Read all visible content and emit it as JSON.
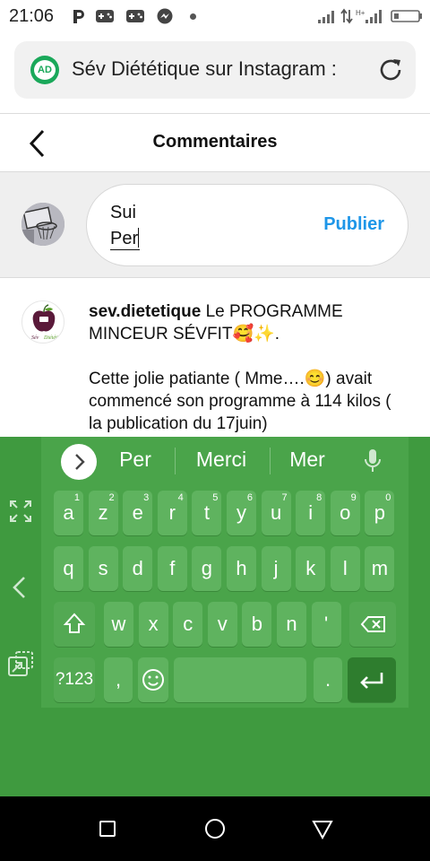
{
  "status_bar": {
    "time": "21:06",
    "icons": [
      "parking-icon",
      "gamepad-icon",
      "gamepad-icon",
      "messenger-icon",
      "dot-icon",
      "signal-icon",
      "data-arrows-icon",
      "signal-h-icon",
      "battery-icon"
    ]
  },
  "url_bar": {
    "badge": "AD",
    "title": "Sév Diététique sur Instagram :",
    "accent": "#1aa85a"
  },
  "header": {
    "title": "Commentaires"
  },
  "composer": {
    "line1": "Sui",
    "line2": "Per",
    "publish_label": "Publier",
    "publish_color": "#1e96e8"
  },
  "post": {
    "username": "sev.dietetique",
    "text_part1": " Le PROGRAMME MINCEUR SÉVFIT🥰✨.",
    "text_part2": "Cette jolie patiante ( Mme….😊) avait commencé son programme à 114 kilos ( la publication du 17juin)"
  },
  "keyboard": {
    "background": "#3f9a3f",
    "suggestions": [
      "Per",
      "Merci",
      "Mer"
    ],
    "row1": [
      {
        "key": "a",
        "hint": "1"
      },
      {
        "key": "z",
        "hint": "2"
      },
      {
        "key": "e",
        "hint": "3"
      },
      {
        "key": "r",
        "hint": "4"
      },
      {
        "key": "t",
        "hint": "5"
      },
      {
        "key": "y",
        "hint": "6"
      },
      {
        "key": "u",
        "hint": "7"
      },
      {
        "key": "i",
        "hint": "8"
      },
      {
        "key": "o",
        "hint": "9"
      },
      {
        "key": "p",
        "hint": "0"
      }
    ],
    "row2": [
      "q",
      "s",
      "d",
      "f",
      "g",
      "h",
      "j",
      "k",
      "l",
      "m"
    ],
    "row3": [
      "w",
      "x",
      "c",
      "v",
      "b",
      "n",
      "'"
    ],
    "symbols_key": "?123",
    "comma_key": ",",
    "period_key": "."
  }
}
